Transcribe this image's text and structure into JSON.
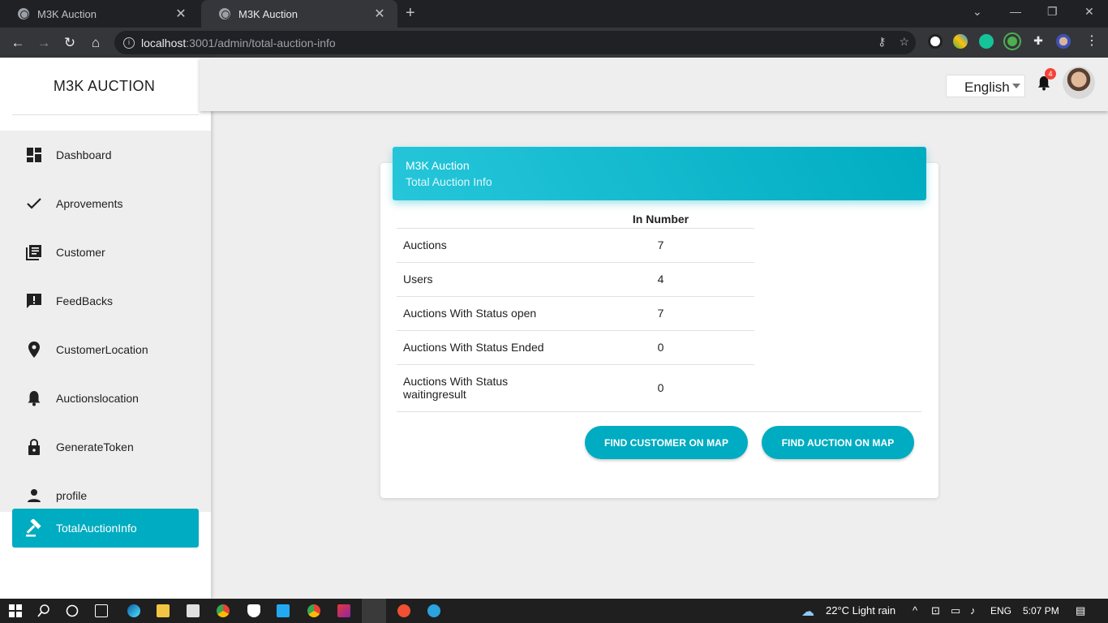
{
  "browser": {
    "tabs": [
      {
        "title": "M3K Auction",
        "active": false
      },
      {
        "title": "M3K Auction",
        "active": true
      }
    ],
    "url_host": "localhost",
    "url_path": ":3001/admin/total-auction-info"
  },
  "sidebar": {
    "brand": "M3K AUCTION",
    "items": [
      {
        "label": "Dashboard",
        "icon": "dashboard-icon"
      },
      {
        "label": "Aprovements",
        "icon": "check-icon"
      },
      {
        "label": "Customer",
        "icon": "library-books-icon"
      },
      {
        "label": "FeedBacks",
        "icon": "feedback-icon"
      },
      {
        "label": "CustomerLocation",
        "icon": "location-pin-icon"
      },
      {
        "label": "Auctionslocation",
        "icon": "bell-icon"
      },
      {
        "label": "GenerateToken",
        "icon": "lock-icon"
      },
      {
        "label": "profile",
        "icon": "person-icon"
      }
    ],
    "active_item": {
      "label": "TotalAuctionInfo",
      "icon": "gavel-icon"
    }
  },
  "appbar": {
    "language": "English",
    "notification_count": "4"
  },
  "card": {
    "title": "M3K Auction",
    "subtitle": "Total Auction Info",
    "column_header": "In Number",
    "rows": [
      {
        "label": "Auctions",
        "value": "7"
      },
      {
        "label": "Users",
        "value": "4"
      },
      {
        "label": "Auctions With Status open",
        "value": "7"
      },
      {
        "label": "Auctions With Status Ended",
        "value": "0"
      },
      {
        "label": "Auctions With Status waitingresult",
        "value": "0"
      }
    ],
    "buttons": {
      "find_customer": "FIND CUSTOMER ON MAP",
      "find_auction": "FIND AUCTION ON MAP"
    }
  },
  "taskbar": {
    "weather": "22°C  Light rain",
    "language": "ENG",
    "time": "5:07 PM"
  },
  "colors": {
    "accent": "#00acc1",
    "accent_light": "#26c6da",
    "badge": "#f44336"
  }
}
